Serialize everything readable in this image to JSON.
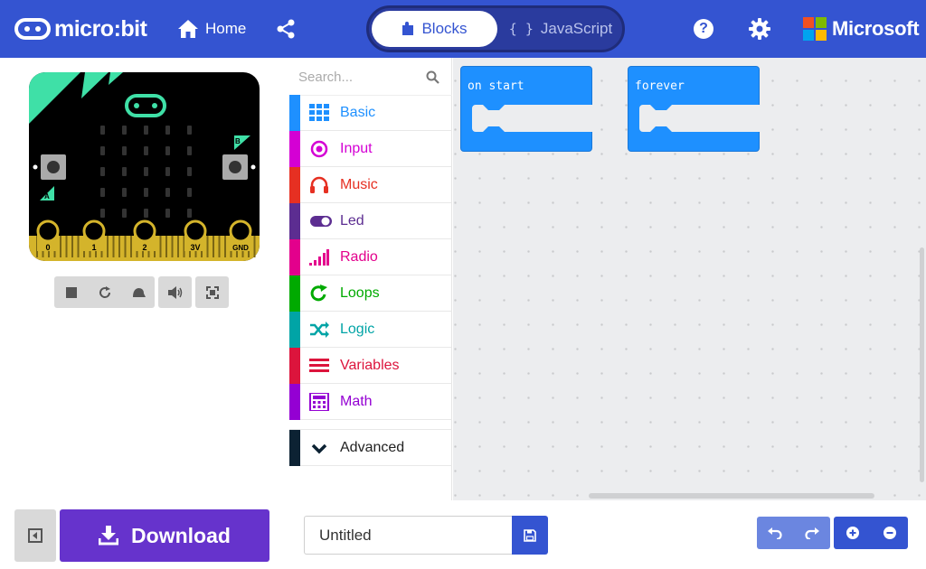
{
  "header": {
    "logo_text": "micro:bit",
    "home_label": "Home",
    "tabs": {
      "blocks_label": "Blocks",
      "javascript_label": "JavaScript",
      "javascript_icon": "{ }"
    },
    "help_glyph": "?",
    "brand_text": "Microsoft",
    "colors": {
      "bar": "#3454d1",
      "ms_red": "#f25022",
      "ms_green": "#7fba00",
      "ms_blue": "#00a4ef",
      "ms_yellow": "#ffb900"
    }
  },
  "simulator": {
    "pin_labels": [
      "0",
      "1",
      "2",
      "3V",
      "GND"
    ],
    "button_a": "A",
    "button_b": "B",
    "controls": [
      "stop-icon",
      "restart-icon",
      "slow-motion-icon",
      "mute-icon",
      "fullscreen-icon"
    ]
  },
  "toolbox": {
    "search_placeholder": "Search...",
    "categories": [
      {
        "label": "Basic",
        "color": "#1e90ff",
        "icon": "grid-icon"
      },
      {
        "label": "Input",
        "color": "#d400d4",
        "icon": "target-icon"
      },
      {
        "label": "Music",
        "color": "#e63022",
        "icon": "headphones-icon"
      },
      {
        "label": "Led",
        "color": "#5c2d91",
        "icon": "toggle-icon"
      },
      {
        "label": "Radio",
        "color": "#e3008c",
        "icon": "signal-bars-icon"
      },
      {
        "label": "Loops",
        "color": "#00aa00",
        "icon": "refresh-icon"
      },
      {
        "label": "Logic",
        "color": "#00a4a6",
        "icon": "shuffle-icon"
      },
      {
        "label": "Variables",
        "color": "#dc143c",
        "icon": "lines-icon"
      },
      {
        "label": "Math",
        "color": "#9400d3",
        "icon": "calculator-icon"
      }
    ],
    "advanced": {
      "label": "Advanced",
      "color": "#0c2233",
      "icon": "chevron-down-icon"
    }
  },
  "workspace": {
    "blocks": [
      {
        "label": "on start"
      },
      {
        "label": "forever"
      }
    ]
  },
  "bottombar": {
    "download_label": "Download",
    "project_name": "Untitled"
  }
}
